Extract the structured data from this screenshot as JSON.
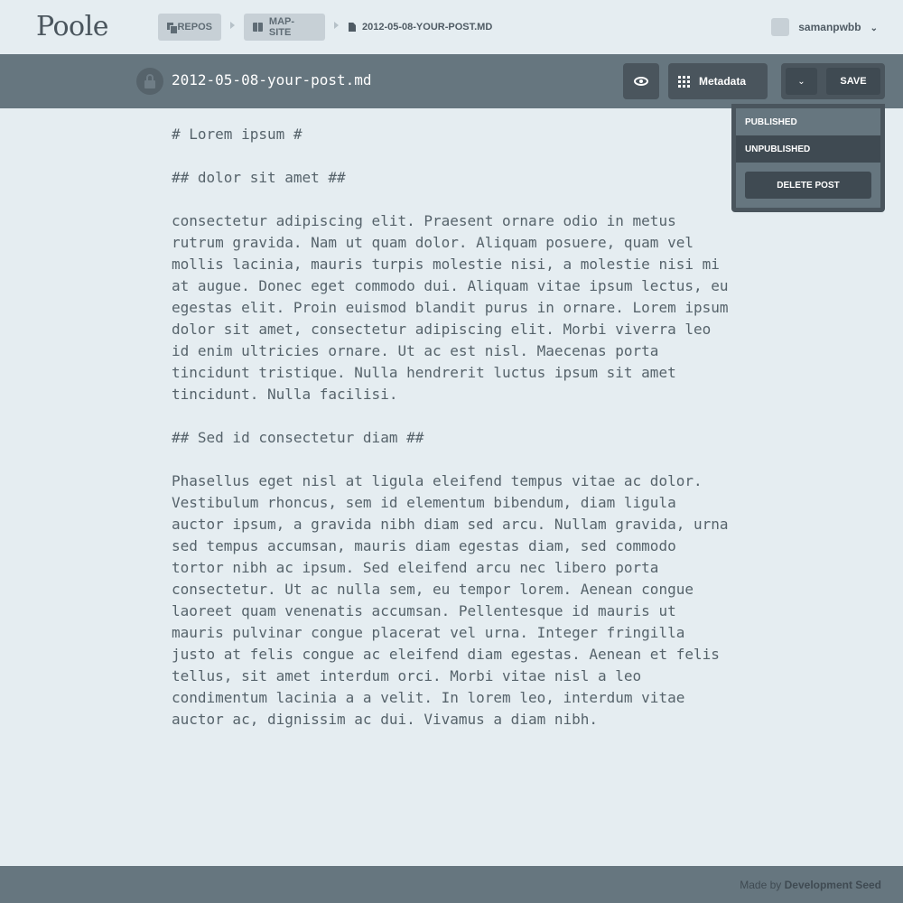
{
  "header": {
    "logo": "Poole",
    "breadcrumbs": [
      {
        "label": "Repos",
        "icon": "repos-icon"
      },
      {
        "label": "Map-site",
        "icon": "book-icon"
      },
      {
        "label": "2012-05-08-your-post.md",
        "icon": "document-icon"
      }
    ],
    "user": {
      "name": "samanpwbb"
    }
  },
  "file_bar": {
    "filename": "2012-05-08-your-post.md",
    "metadata_label": "Metadata",
    "save_label": "Save"
  },
  "dropdown": {
    "items": [
      {
        "label": "Published",
        "selected": false
      },
      {
        "label": "Unpublished",
        "selected": true
      }
    ],
    "delete_label": "Delete Post"
  },
  "editor": {
    "lines": [
      "# Lorem ipsum #",
      "",
      "## dolor sit amet ##",
      "",
      "consectetur adipiscing elit. Praesent ornare odio in metus",
      "rutrum gravida. Nam ut quam dolor. Aliquam posuere, quam vel",
      "mollis lacinia, mauris turpis molestie nisi, a molestie nisi mi",
      "at augue. Donec eget commodo dui. Aliquam vitae ipsum lectus, eu",
      "egestas elit. Proin euismod blandit purus in ornare. Lorem ipsum",
      "dolor sit amet, consectetur adipiscing elit. Morbi viverra leo",
      "id enim ultricies ornare. Ut ac est nisl. Maecenas porta",
      "tincidunt tristique. Nulla hendrerit luctus ipsum sit amet",
      "tincidunt. Nulla facilisi.",
      "",
      "## Sed id consectetur diam ##",
      "",
      "Phasellus eget nisl at ligula eleifend tempus vitae ac dolor.",
      "Vestibulum rhoncus, sem id elementum bibendum, diam ligula",
      "auctor ipsum, a gravida nibh diam sed arcu. Nullam gravida, urna",
      "sed tempus accumsan, mauris diam egestas diam, sed commodo",
      "tortor nibh ac ipsum. Sed eleifend arcu nec libero porta",
      "consectetur. Ut ac nulla sem, eu tempor lorem. Aenean congue",
      "laoreet quam venenatis accumsan. Pellentesque id mauris ut",
      "mauris pulvinar congue placerat vel urna. Integer fringilla",
      "justo at felis congue ac eleifend diam egestas. Aenean et felis",
      "tellus, sit amet interdum orci. Morbi vitae nisl a leo",
      "condimentum lacinia a a velit. In lorem leo, interdum vitae",
      "auctor ac, dignissim ac dui. Vivamus a diam nibh."
    ]
  },
  "footer": {
    "made_by": "Made by",
    "company": "Development Seed"
  },
  "colors": {
    "background": "#e5edf1",
    "bar": "#66767f",
    "dark": "#3f4a52",
    "pill": "#c7d0d6"
  }
}
